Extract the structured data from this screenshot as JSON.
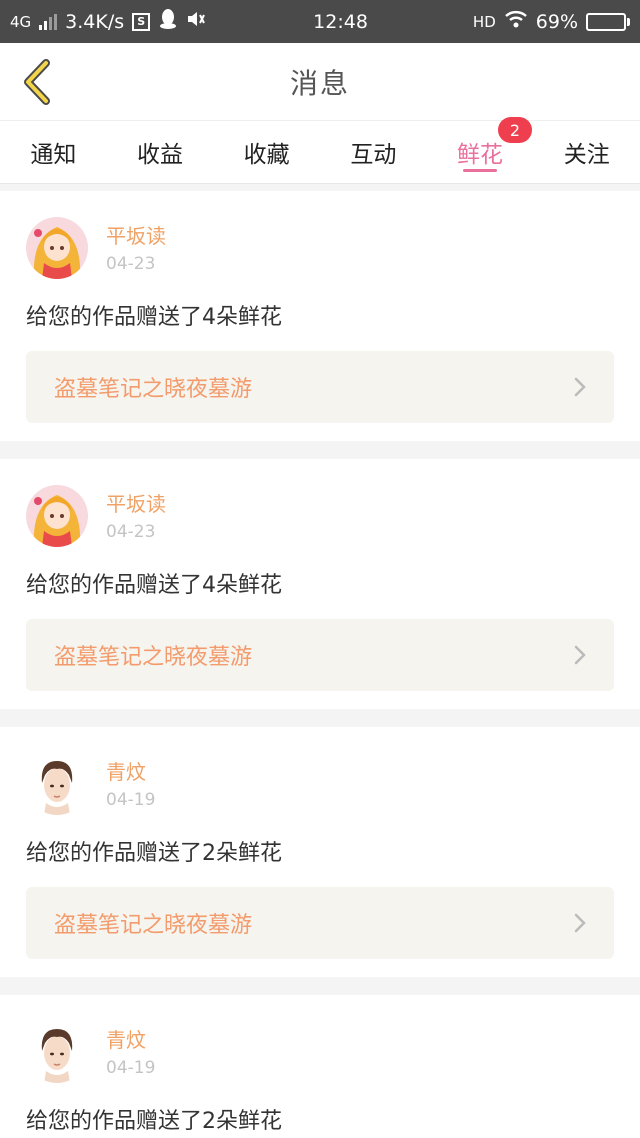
{
  "status_bar": {
    "network": "4G",
    "speed": "3.4K/s",
    "time": "12:48",
    "hd": "HD",
    "battery": "69%",
    "battery_level": 0.69
  },
  "header": {
    "title": "消息"
  },
  "tabs": [
    {
      "label": "通知"
    },
    {
      "label": "收益"
    },
    {
      "label": "收藏"
    },
    {
      "label": "互动"
    },
    {
      "label": "鲜花",
      "active": true,
      "badge": "2"
    },
    {
      "label": "关注"
    }
  ],
  "messages": [
    {
      "user": "平坂读",
      "date": "04-23",
      "text": "给您的作品赠送了4朵鲜花",
      "book": "盗墓笔记之晓夜墓游",
      "avatar": "anime-girl-avatar"
    },
    {
      "user": "平坂读",
      "date": "04-23",
      "text": "给您的作品赠送了4朵鲜花",
      "book": "盗墓笔记之晓夜墓游",
      "avatar": "anime-girl-avatar"
    },
    {
      "user": "青炆",
      "date": "04-19",
      "text": "给您的作品赠送了2朵鲜花",
      "book": "盗墓笔记之晓夜墓游",
      "avatar": "anime-boy-avatar"
    },
    {
      "user": "青炆",
      "date": "04-19",
      "text": "给您的作品赠送了2朵鲜花",
      "book": "",
      "avatar": "anime-boy-avatar"
    }
  ],
  "colors": {
    "accent": "#e9709c",
    "username": "#f0a266",
    "book_link": "#f39b6c",
    "badge": "#ef3f4f"
  }
}
